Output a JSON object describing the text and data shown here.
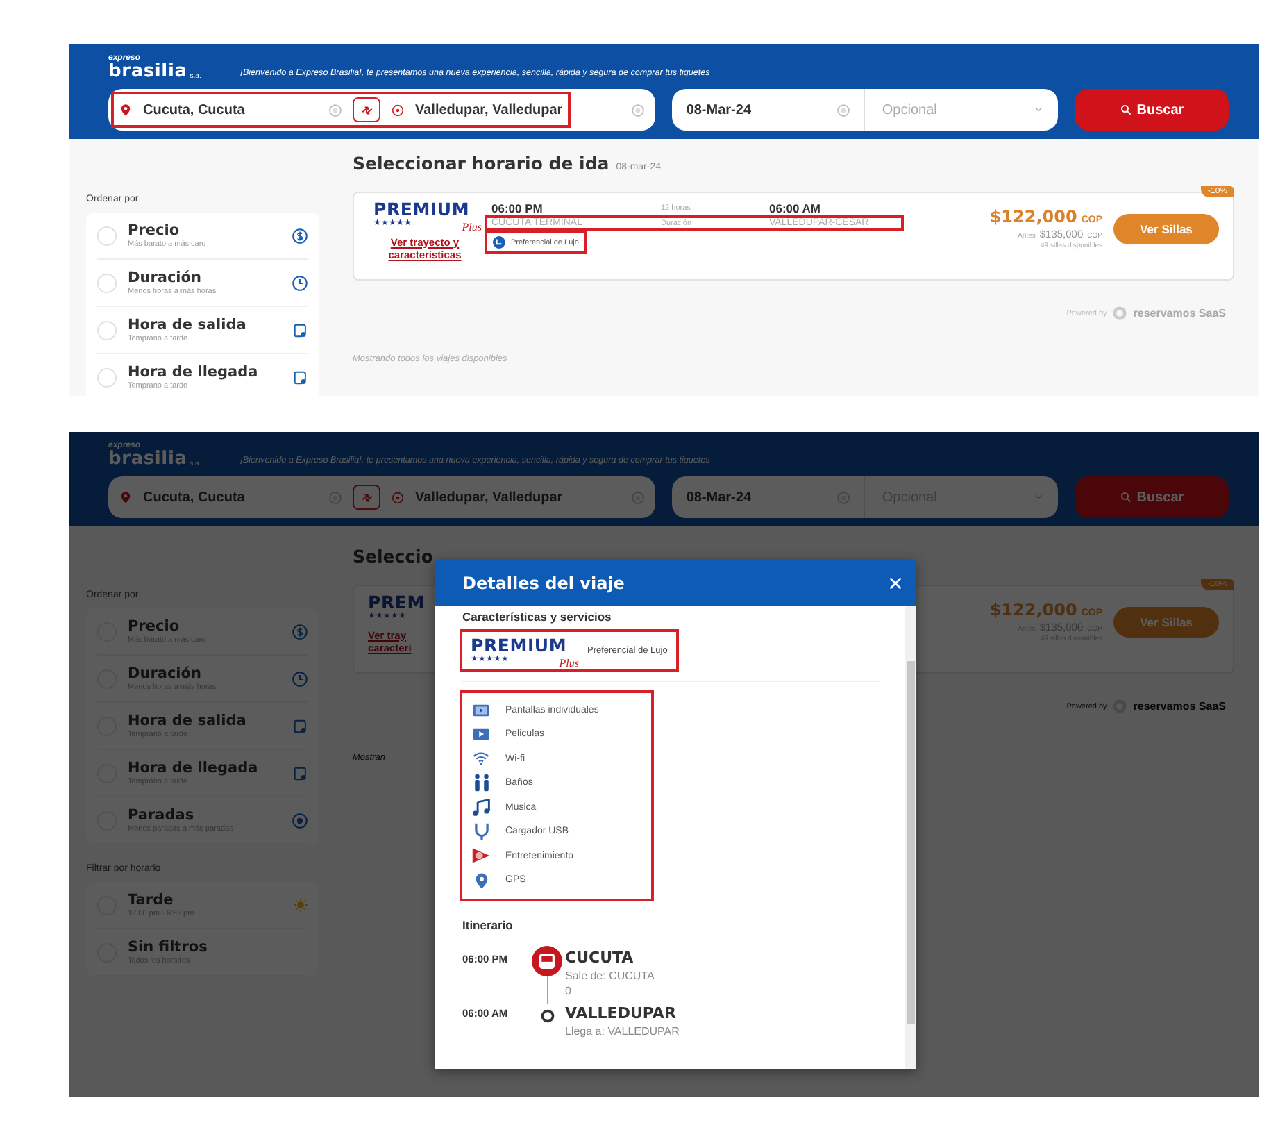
{
  "top_view": {
    "header": {
      "logo_top": "expreso",
      "logo_main": "brasilia",
      "logo_suffix": "s.a.",
      "welcome": "¡Bienvenido a Expreso Brasilia!, te presentamos una nueva experiencia, sencilla, rápida y segura de comprar tus tiquetes"
    },
    "search": {
      "route_highlighted": true,
      "origin": "Cucuta, Cucuta",
      "destination": "Valledupar, Valledupar",
      "date": "08-Mar-24",
      "return_placeholder": "Opcional",
      "button": "Buscar"
    },
    "sort": {
      "label": "Ordenar por",
      "options": [
        {
          "kind": "price",
          "title": "Precio",
          "subtitle": "Más barato a más caro",
          "selected": false
        },
        {
          "kind": "duration",
          "title": "Duración",
          "subtitle": "Menos horas a más horas",
          "selected": false
        },
        {
          "kind": "departure",
          "title": "Hora de salida",
          "subtitle": "Temprano a tarde",
          "selected": false
        },
        {
          "kind": "arrival",
          "title": "Hora de llegada",
          "subtitle": "Temprano a tarde",
          "selected": false
        }
      ]
    },
    "results": {
      "title": "Seleccionar horario de ida",
      "date": "08-mar-24",
      "trip": {
        "logo_word": "PREMIUM",
        "logo_stars": "★★★★★",
        "logo_script": "Plus",
        "link": "Ver trayecto y características",
        "departure_time": "06:00 PM",
        "duration": "12 horas",
        "arrival_time": "06:00 AM",
        "origin": "CUCUTA TERMINAL",
        "duration_label": "Duración",
        "destination": "VALLEDUPAR-CESAR",
        "route_highlighted": true,
        "service": "Preferencial de Lujo",
        "service_highlighted": true,
        "price": "$122,000",
        "currency": "COP",
        "old_label": "Antes",
        "old_price": "$135,000",
        "old_currency": "COP",
        "seats": "49 sillas disponibles",
        "button": "Ver Sillas",
        "discount": "-10%"
      },
      "powered_label": "Powered by",
      "powered_brand": "reservamos SaaS",
      "footer": "Mostrando todos los viajes disponibles"
    }
  },
  "bottom_view": {
    "header": {
      "logo_top": "expreso",
      "logo_main": "brasilia",
      "logo_suffix": "s.a.",
      "welcome": "¡Bienvenido a Expreso Brasilia!, te presentamos una nueva experiencia, sencilla, rápida y segura de comprar tus tiquetes"
    },
    "search": {
      "route_highlighted": false,
      "origin": "Cucuta, Cucuta",
      "destination": "Valledupar, Valledupar",
      "date": "08-Mar-24",
      "return_placeholder": "Opcional",
      "button": "Buscar"
    },
    "sort": {
      "label": "Ordenar por",
      "options": [
        {
          "kind": "price",
          "title": "Precio",
          "subtitle": "Más barato a más caro",
          "selected": false
        },
        {
          "kind": "duration",
          "title": "Duración",
          "subtitle": "Menos horas a más horas",
          "selected": false
        },
        {
          "kind": "departure",
          "title": "Hora de salida",
          "subtitle": "Temprano a tarde",
          "selected": false
        },
        {
          "kind": "arrival",
          "title": "Hora de llegada",
          "subtitle": "Temprano a tarde",
          "selected": false
        },
        {
          "kind": "stops",
          "title": "Paradas",
          "subtitle": "Menos paradas a más paradas",
          "selected": false
        }
      ]
    },
    "filter": {
      "label": "Filtrar por horario",
      "options": [
        {
          "kind": "afternoon",
          "title": "Tarde",
          "subtitle": "12:00 pm - 6:59 pm",
          "selected": false
        },
        {
          "kind": "all",
          "title": "Sin filtros",
          "subtitle": "Todos los horarios",
          "selected": false
        }
      ]
    },
    "background": {
      "title_part": "Seleccio",
      "logo_part": "PREM",
      "logo_stars": "★★★★★",
      "link_lines": [
        "Ver tray",
        "caracterí"
      ],
      "footer_part": "Mostran",
      "price": "$122,000",
      "currency": "COP",
      "old_label": "Antes",
      "old_price": "$135,000",
      "old_currency": "COP",
      "seats": "49 sillas disponibles",
      "button": "Ver Sillas",
      "discount": "-10%",
      "powered_label": "Powered by",
      "powered_brand": "reservamos SaaS"
    },
    "modal": {
      "title": "Detalles del viaje",
      "section": "Características y servicios",
      "bus": {
        "logo_word": "PREMIUM",
        "logo_stars": "★★★★★",
        "logo_script": "Plus",
        "service": "Preferencial de Lujo",
        "highlighted": true
      },
      "amenities_highlighted": true,
      "amenities": [
        {
          "kind": "screens",
          "label": "Pantallas individuales"
        },
        {
          "kind": "movies",
          "label": "Peliculas"
        },
        {
          "kind": "wifi",
          "label": "Wi-fi"
        },
        {
          "kind": "restrooms",
          "label": "Baños"
        },
        {
          "kind": "music",
          "label": "Musica"
        },
        {
          "kind": "usb",
          "label": "Cargador USB"
        },
        {
          "kind": "entertainment",
          "label": "Entretenimiento"
        },
        {
          "kind": "gps",
          "label": "GPS"
        }
      ],
      "itinerary_label": "Itinerario",
      "stops": [
        {
          "kind": "origin",
          "time": "06:00 PM",
          "name": "CUCUTA",
          "detail": "Sale de: CUCUTA",
          "extra": "0"
        },
        {
          "kind": "destination",
          "time": "06:00 AM",
          "name": "VALLEDUPAR",
          "detail": "Llega a: VALLEDUPAR"
        }
      ]
    }
  }
}
